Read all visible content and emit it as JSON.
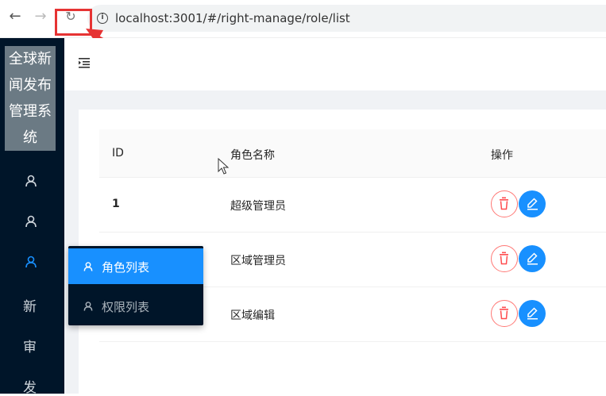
{
  "browser": {
    "back_icon": "←",
    "forward_icon": "→",
    "reload_icon": "↻",
    "info_icon": "i",
    "url": "localhost:3001/#/right-manage/role/list"
  },
  "sidebar": {
    "logo": "全球新闻发布管理系统",
    "logo_lines": [
      "全球新",
      "闻发布",
      "管理系",
      "统"
    ],
    "items": [
      {
        "type": "icon",
        "icon": "user-icon"
      },
      {
        "type": "icon",
        "icon": "user-icon"
      },
      {
        "type": "icon",
        "icon": "user-icon",
        "active": true
      },
      {
        "type": "text",
        "label": "新"
      },
      {
        "type": "text",
        "label": "审"
      },
      {
        "type": "text",
        "label": "发"
      }
    ]
  },
  "submenu": {
    "items": [
      {
        "label": "角色列表",
        "icon": "user-icon",
        "active": true
      },
      {
        "label": "权限列表",
        "icon": "user-icon",
        "active": false
      }
    ]
  },
  "table": {
    "columns": [
      "ID",
      "角色名称",
      "操作"
    ],
    "rows": [
      {
        "id": "1",
        "name": "超级管理员"
      },
      {
        "id": "",
        "name": "区域管理员"
      },
      {
        "id": "",
        "name": "区域编辑"
      }
    ]
  },
  "colors": {
    "sidebar_bg": "#001529",
    "primary": "#1890ff",
    "danger": "#ff4d4f",
    "annotation_red": "#e63333"
  }
}
